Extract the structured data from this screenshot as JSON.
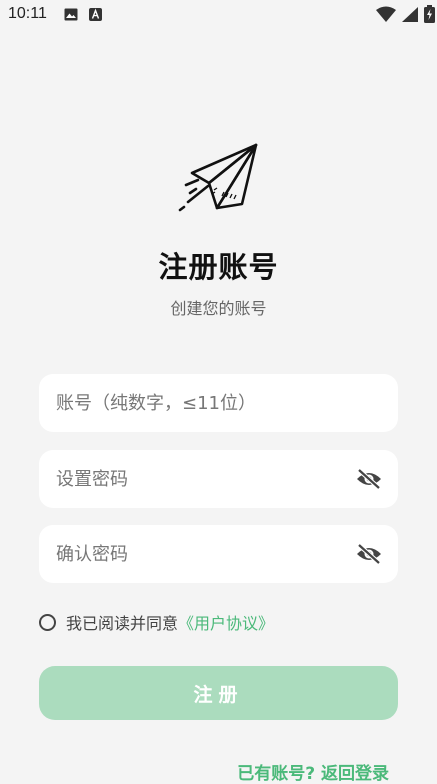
{
  "status_bar": {
    "time": "10:11",
    "left_icons": [
      "image-icon",
      "a-badge-icon"
    ],
    "right_icons": [
      "wifi-icon",
      "signal-icon",
      "battery-icon"
    ]
  },
  "header": {
    "logo_icon": "paper-plane-icon",
    "title": "注册账号",
    "subtitle": "创建您的账号"
  },
  "form": {
    "account_placeholder": "账号（纯数字，≤11位）",
    "password_placeholder": "设置密码",
    "confirm_placeholder": "确认密码",
    "visibility_icon": "eye-off-icon"
  },
  "agreement": {
    "text": "我已阅读并同意",
    "link": "《用户协议》"
  },
  "actions": {
    "register_label": "注册",
    "login_link": "已有账号? 返回登录"
  },
  "colors": {
    "accent": "#4bb97a",
    "button_disabled": "#abdcbe",
    "background": "#f4f4f4"
  }
}
